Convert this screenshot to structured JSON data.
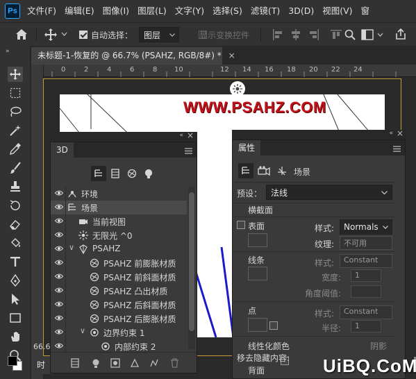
{
  "app": {
    "logo": "Ps"
  },
  "menu": [
    "文件(F)",
    "编辑(E)",
    "图像(I)",
    "图层(L)",
    "文字(Y)",
    "选择(S)",
    "滤镜(T)",
    "3D(D)",
    "视图(V)",
    "窗"
  ],
  "options": {
    "auto_select_label": "自动选择：",
    "auto_select_checked": true,
    "layer_select_value": "图层",
    "show_transform_label": "显示变换控件",
    "show_transform_checked": false
  },
  "document": {
    "tab_title": "未标题-1-恢复的 @ 66.7% (PSAHZ, RGB/8#) *",
    "close_glyph": "×",
    "ruler_labels": [
      "2",
      "0",
      "2",
      "4",
      "6",
      "8",
      "10",
      "12",
      "14",
      "16",
      "18",
      "20",
      "22",
      "24"
    ],
    "canvas_text": "WWW.PSAHZ.COM",
    "zoom_text": "66.6",
    "timeline_tab": "时间"
  },
  "panel_3d": {
    "title": "3D",
    "rows": [
      {
        "label": "环境",
        "icon": "environment-icon",
        "indent": 0
      },
      {
        "label": "场景",
        "icon": "scene-icon",
        "indent": 0,
        "selected": true
      },
      {
        "label": "当前视图",
        "icon": "camera-icon",
        "indent": 1
      },
      {
        "label": "无限光 ^0",
        "icon": "light-icon",
        "indent": 1
      },
      {
        "label": "PSAHZ",
        "icon": "mesh-icon",
        "indent": 1,
        "expander": "∨"
      },
      {
        "label": "PSAHZ 前膨胀材质",
        "icon": "material-icon",
        "indent": 2
      },
      {
        "label": "PSAHZ 前斜面材质",
        "icon": "material-icon",
        "indent": 2
      },
      {
        "label": "PSAHZ 凸出材质",
        "icon": "material-icon",
        "indent": 2
      },
      {
        "label": "PSAHZ 后斜面材质",
        "icon": "material-icon",
        "indent": 2
      },
      {
        "label": "PSAHZ 后膨胀材质",
        "icon": "material-icon",
        "indent": 2
      },
      {
        "label": "边界约束 1",
        "icon": "constraint-icon",
        "indent": 2,
        "expander": "∨"
      },
      {
        "label": "内部约束 2",
        "icon": "constraint-icon",
        "indent": 3
      }
    ]
  },
  "panel_props": {
    "title": "属性",
    "scene_label": "场景",
    "preset_label": "预设：",
    "preset_value": "法线",
    "cross_section_label": "横截面",
    "cross_section_checked": false,
    "surface_label": "表面",
    "surface_checked": true,
    "style_label": "样式:",
    "surface_style_value": "Normals",
    "texture_label": "纹理:",
    "texture_value": "不可用",
    "lines_label": "线条",
    "lines_checked": false,
    "lines_style_value": "Constant",
    "width_label": "宽度:",
    "width_value": "1",
    "angle_label": "角度阈值:",
    "points_label": "点",
    "points_checked": false,
    "points_style_value": "Constant",
    "radius_label": "半径:",
    "radius_value": "1",
    "linearize_label": "线性化颜色",
    "linearize_checked": false,
    "shadow_label": "阴影",
    "shadow_checked": true,
    "hidden_label": "移去隐藏内容:",
    "back_label": "背面",
    "back_checked": false
  },
  "watermark": "UiBQ.CoM",
  "colors": {
    "accent": "#c79a3a",
    "panel_bg": "#3a3a3a",
    "selected_row": "#4a4a4a",
    "canvas_text": "#c0121a"
  }
}
